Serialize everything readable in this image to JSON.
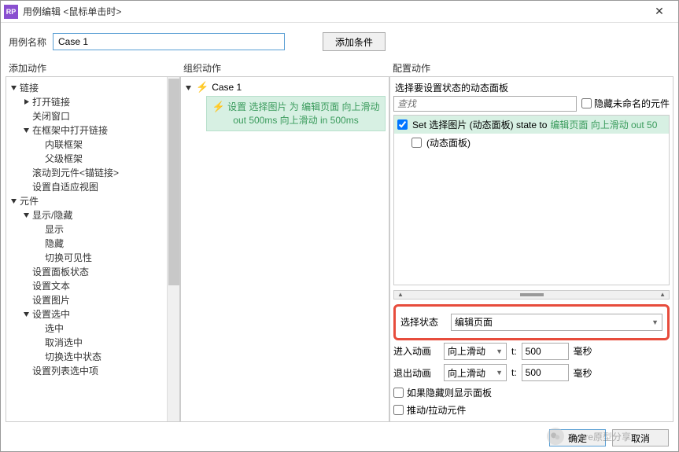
{
  "window": {
    "icon_text": "RP",
    "title": "用例编辑 <鼠标单击时>",
    "close": "✕"
  },
  "name_row": {
    "label": "用例名称",
    "value": "Case 1",
    "add_condition": "添加条件"
  },
  "columns": {
    "add_action": "添加动作",
    "organize_action": "组织动作",
    "config_action": "配置动作"
  },
  "tree": {
    "links": "链接",
    "open_link": "打开链接",
    "close_window": "关闭窗口",
    "open_in_frame": "在框架中打开链接",
    "inline_frame": "内联框架",
    "parent_frame": "父级框架",
    "scroll_anchor": "滚动到元件<锚链接>",
    "adaptive_view": "设置自适应视图",
    "widgets": "元件",
    "show_hide": "显示/隐藏",
    "show": "显示",
    "hide": "隐藏",
    "toggle_vis": "切换可见性",
    "panel_state": "设置面板状态",
    "set_text": "设置文本",
    "set_image": "设置图片",
    "set_selected": "设置选中",
    "selected": "选中",
    "unselected": "取消选中",
    "toggle_selected": "切换选中状态",
    "set_list_selected": "设置列表选中项"
  },
  "case": {
    "name": "Case 1",
    "action_prefix": "设置",
    "action_body": "选择图片 为 编辑页面 向上滑动 out 500ms 向上滑动 in 500ms"
  },
  "config": {
    "header": "选择要设置状态的动态面板",
    "search_placeholder": "查找",
    "hide_unnamed": "隐藏未命名的元件",
    "item1_prefix": "Set 选择图片 (动态面板) state to",
    "item1_suffix": "编辑页面 向上滑动 out 50",
    "item2": "(动态面板)"
  },
  "form": {
    "select_state": "选择状态",
    "state_value": "编辑页面",
    "enter_anim": "进入动画",
    "exit_anim": "退出动画",
    "anim_value": "向上滑动",
    "t_label": "t:",
    "duration": "500",
    "ms": "毫秒",
    "show_if_hidden": "如果隐藏则显示面板",
    "push_pull": "推动/拉动元件"
  },
  "footer": {
    "ok": "确定",
    "cancel": "取消"
  },
  "watermark": "Axure原型分享"
}
